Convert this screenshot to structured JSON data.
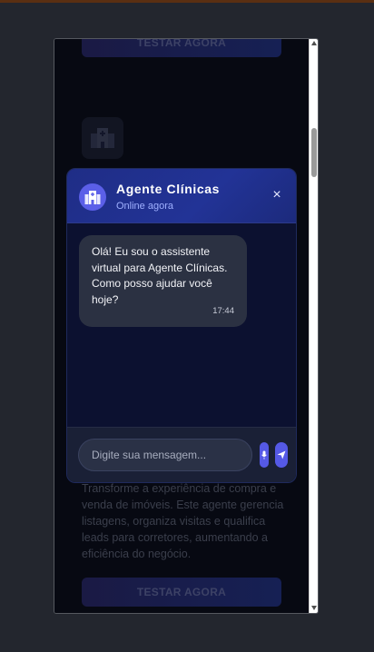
{
  "background_page": {
    "cta_label": "TESTAR AGORA",
    "description": "Transforme a experiência de compra e venda de imóveis. Este agente gerencia listagens, organiza visitas e qualifica leads para corretores, aumentando a eficiência do negócio.",
    "card_icon": "hospital-icon"
  },
  "chat": {
    "title": "Agente Clínicas",
    "status": "Online agora",
    "avatar_icon": "hospital-icon",
    "close_icon": "close-icon",
    "close_glyph": "×",
    "messages": [
      {
        "sender": "bot",
        "text": "Olá! Eu sou o assistente virtual para Agente Clínicas. Como posso ajudar você hoje?",
        "time": "17:44"
      }
    ],
    "input": {
      "placeholder": "Digite sua mensagem...",
      "value": ""
    },
    "mic_icon": "microphone-icon",
    "send_icon": "send-icon"
  },
  "colors": {
    "accent": "#5559e6",
    "header_bg": "#223396",
    "bubble_bg": "#2b3142",
    "page_bg": "#23262e"
  }
}
